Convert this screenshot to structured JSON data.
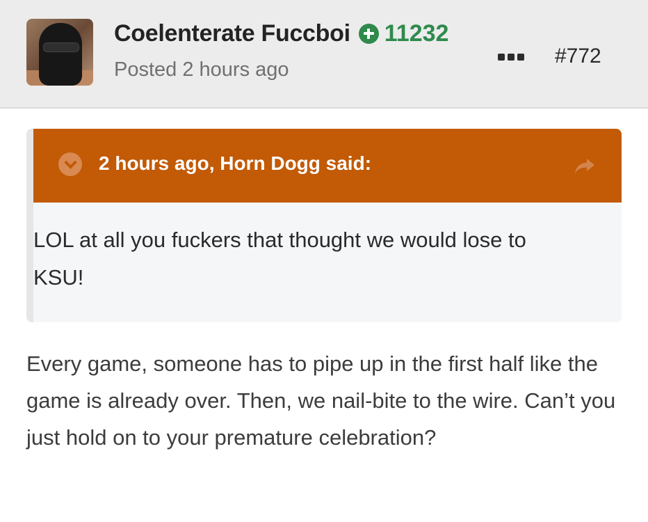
{
  "author": {
    "name": "Coelenterate Fuccboi",
    "reputation": "11232",
    "posted": "Posted 2 hours ago"
  },
  "post": {
    "number": "#772",
    "body": "Every game, someone has to pipe up in the first half like the game is already over. Then, we nail-bite to the wire. Can’t you just hold on to your premature celebration?"
  },
  "quote": {
    "citation": "2 hours ago, Horn Dogg said:",
    "text": "LOL at all you fuckers that thought we would lose to KSU!"
  },
  "icons": {
    "reputation": "plus-circle-icon",
    "more": "ellipsis-icon",
    "collapse": "chevron-down-icon",
    "share": "share-arrow-icon"
  },
  "colors": {
    "header_background": "#ececec",
    "reputation_green": "#2f8a4c",
    "quote_header_orange": "#c25a06",
    "quote_body_background": "#f4f6f8"
  }
}
